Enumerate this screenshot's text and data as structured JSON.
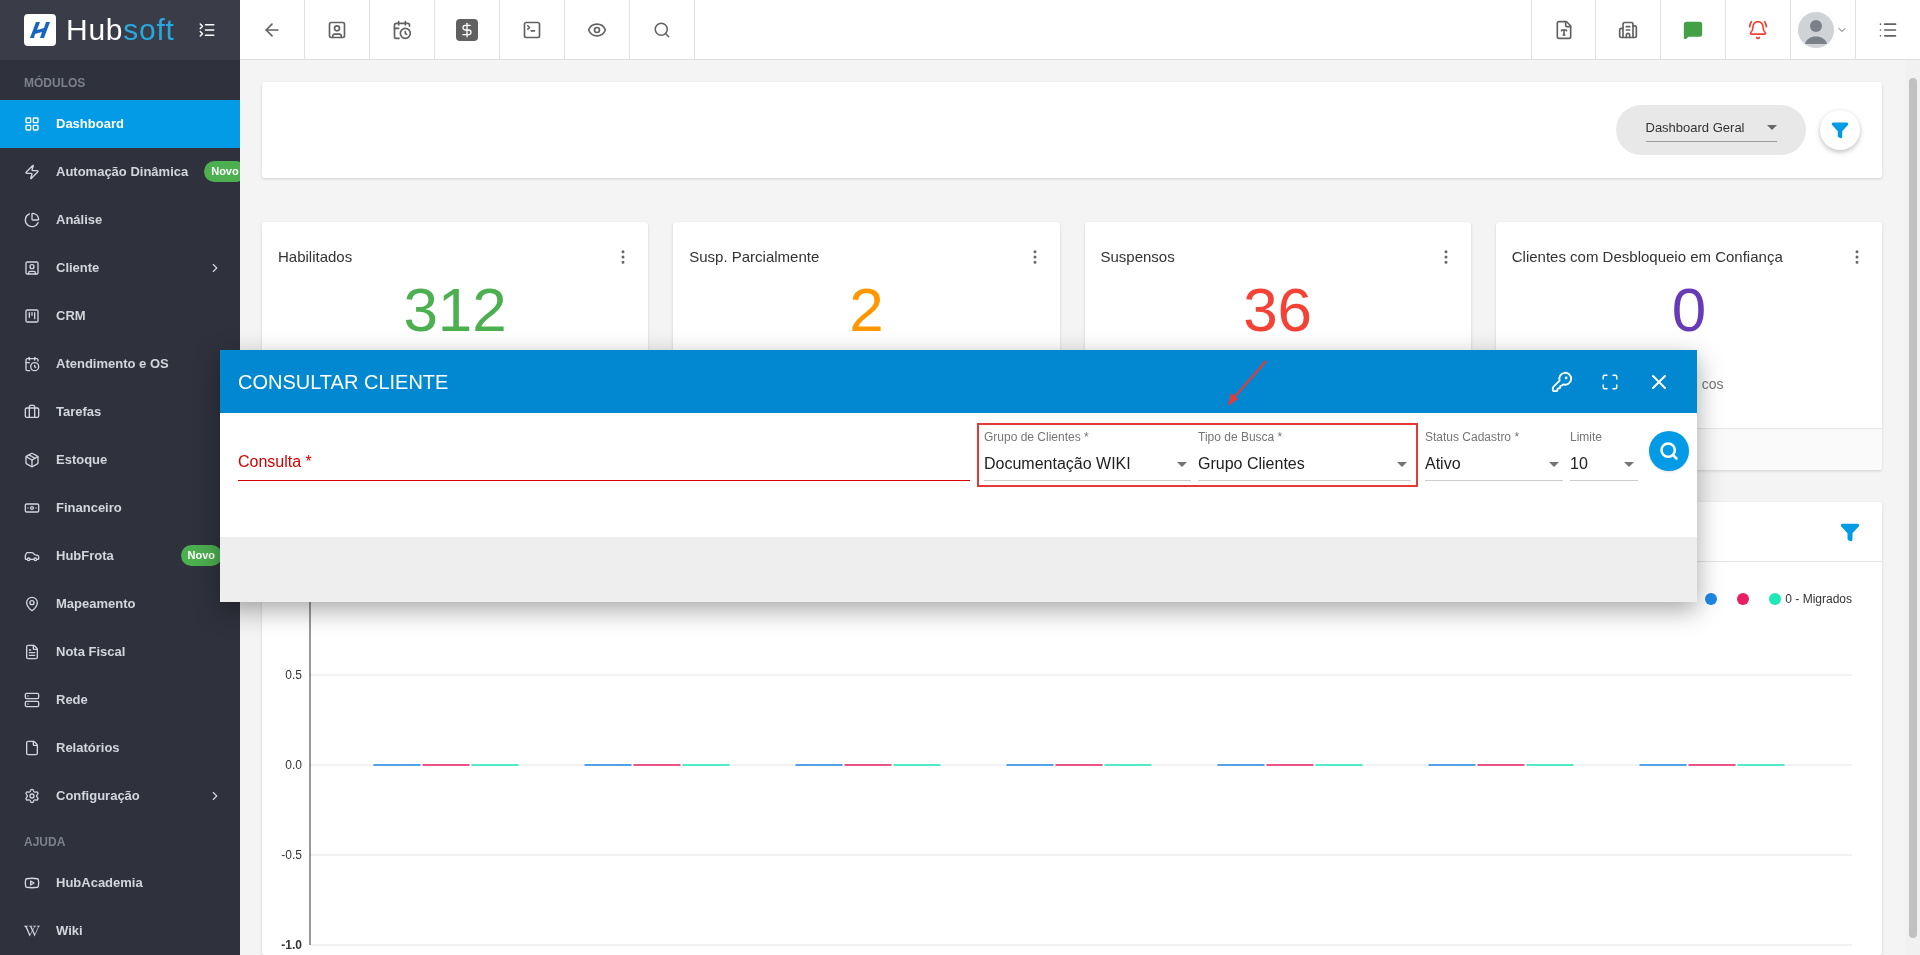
{
  "logo": {
    "text_parts": [
      "Hub",
      "soft"
    ]
  },
  "sidebar": {
    "sections": [
      {
        "title": "MÓDULOS",
        "items": [
          {
            "label": "Dashboard",
            "selected": true,
            "submenu": false
          },
          {
            "label": "Automação Dinâmica",
            "selected": false,
            "submenu": false,
            "badge": "Novo"
          },
          {
            "label": "Análise",
            "selected": false,
            "submenu": false
          },
          {
            "label": "Cliente",
            "selected": false,
            "submenu": true
          },
          {
            "label": "CRM",
            "selected": false,
            "submenu": false
          },
          {
            "label": "Atendimento e OS",
            "selected": false,
            "submenu": false
          },
          {
            "label": "Tarefas",
            "selected": false,
            "submenu": false
          },
          {
            "label": "Estoque",
            "selected": false,
            "submenu": false
          },
          {
            "label": "Financeiro",
            "selected": false,
            "submenu": false
          },
          {
            "label": "HubFrota",
            "selected": false,
            "submenu": false,
            "badge": "Novo"
          },
          {
            "label": "Mapeamento",
            "selected": false,
            "submenu": false
          },
          {
            "label": "Nota Fiscal",
            "selected": false,
            "submenu": false
          },
          {
            "label": "Rede",
            "selected": false,
            "submenu": false
          },
          {
            "label": "Relatórios",
            "selected": false,
            "submenu": false
          },
          {
            "label": "Configuração",
            "selected": false,
            "submenu": true
          }
        ]
      },
      {
        "title": "AJUDA",
        "items": [
          {
            "label": "HubAcademia",
            "selected": false,
            "submenu": false
          },
          {
            "label": "Wiki",
            "selected": false,
            "submenu": false
          }
        ]
      }
    ]
  },
  "dashboard_select": {
    "value": "Dashboard Geral"
  },
  "cards": [
    {
      "title": "Habilitados",
      "value": "312",
      "color": "#4caf50"
    },
    {
      "title": "Susp. Parcialmente",
      "value": "2",
      "color": "#ff9800"
    },
    {
      "title": "Suspensos",
      "value": "36",
      "color": "#f44336"
    },
    {
      "title": "Clientes com Desbloqueio em Confiança",
      "value": "0",
      "color": "#673ab7",
      "caption": "cos"
    }
  ],
  "chart_panel": {
    "chart_data": {
      "type": "bar",
      "ylim": [
        -1,
        1
      ],
      "grid": true,
      "yticks": [
        {
          "value": 0.5,
          "label": "0.5"
        },
        {
          "value": 0,
          "label": "0.0"
        },
        {
          "value": -0.5,
          "label": "-0.5"
        },
        {
          "value": -1,
          "label": "-1.0"
        }
      ],
      "series": [
        {
          "color": "#1e88e5",
          "values": [
            0,
            0,
            0,
            0,
            0,
            0,
            0
          ]
        },
        {
          "color": "#e91e63",
          "values": [
            0,
            0,
            0,
            0,
            0,
            0,
            0
          ]
        },
        {
          "name": "0 - Migrados",
          "color": "#1de9b6",
          "values": [
            0,
            0,
            0,
            0,
            0,
            0,
            0
          ]
        }
      ]
    }
  },
  "modal": {
    "title": "CONSULTAR CLIENTE",
    "fields": [
      {
        "kind": "text",
        "label": "Consulta *",
        "invalid": true,
        "highlighted": false
      },
      {
        "kind": "select",
        "label": "Grupo de Clientes *",
        "value": "Documentação WIKI",
        "highlighted": true
      },
      {
        "kind": "select",
        "label": "Tipo de Busca *",
        "value": "Grupo Clientes",
        "highlighted": true
      },
      {
        "kind": "select",
        "label": "Status Cadastro *",
        "value": "Ativo",
        "highlighted": false
      },
      {
        "kind": "select",
        "label": "Limite",
        "value": "10",
        "highlighted": false
      }
    ]
  }
}
